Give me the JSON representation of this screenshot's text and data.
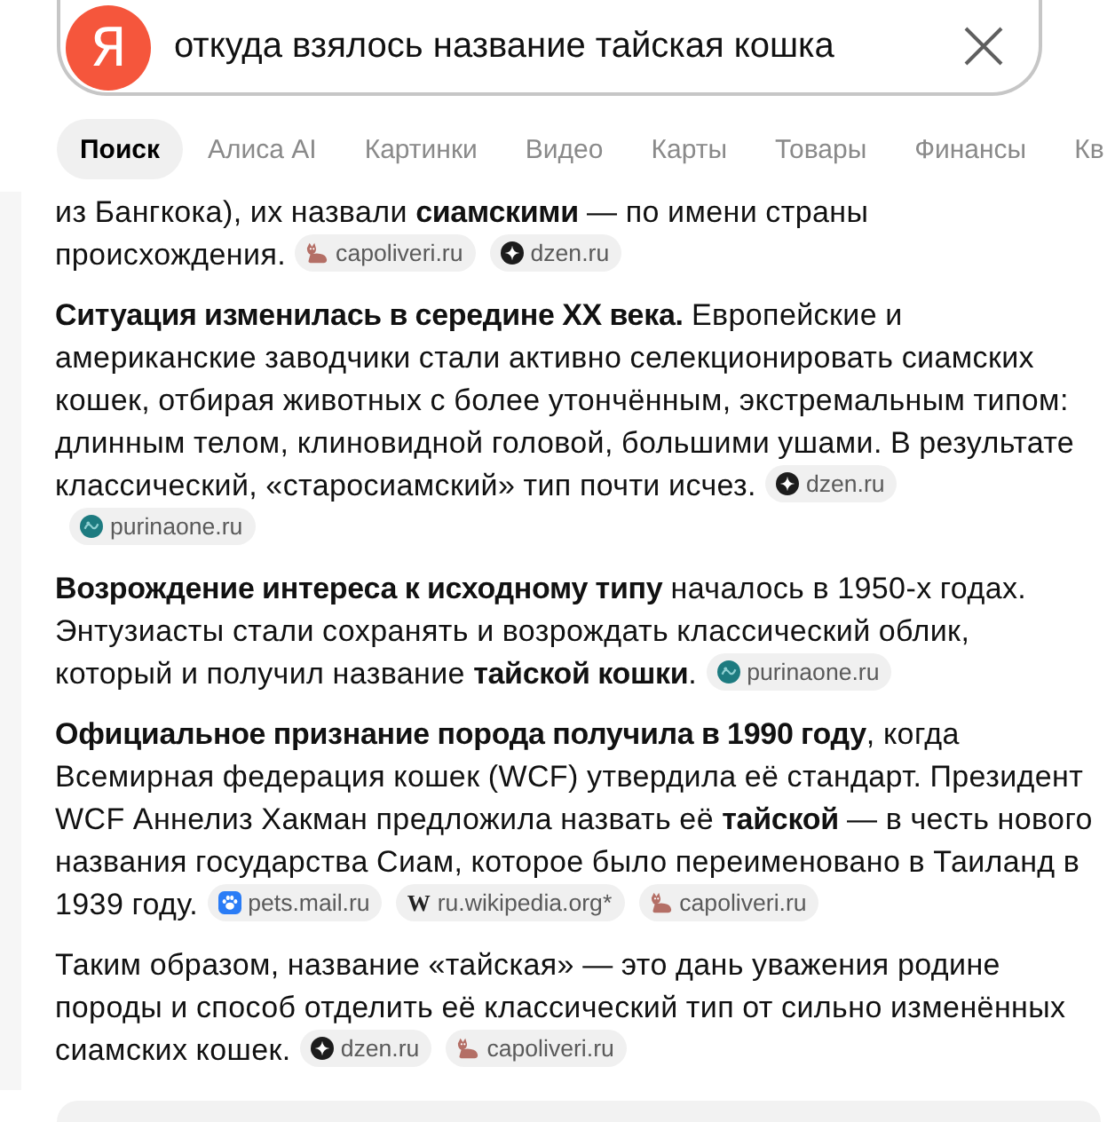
{
  "search": {
    "logo": "Я",
    "query": "откуда взялось название тайская кошка"
  },
  "tabs": [
    {
      "label": "Поиск",
      "selected": true
    },
    {
      "label": "Алиса AI",
      "selected": false
    },
    {
      "label": "Картинки",
      "selected": false
    },
    {
      "label": "Видео",
      "selected": false
    },
    {
      "label": "Карты",
      "selected": false
    },
    {
      "label": "Товары",
      "selected": false
    },
    {
      "label": "Финансы",
      "selected": false
    },
    {
      "label": "Кв",
      "selected": false
    }
  ],
  "answer": {
    "paragraphs": [
      {
        "text": "из Бангкока), их назвали **сиамскими** — по имени страны происхождения.",
        "sources": [
          {
            "name": "capoliveri.ru",
            "kind": "cat"
          },
          {
            "name": "dzen.ru",
            "kind": "sparkle"
          }
        ]
      },
      {
        "text": "**Ситуация изменилась в середине XX века.** Европейские и американские заводчики стали активно селекционировать сиамских кошек, отбирая животных с более утончённым, экстремальным типом: длинным телом, клиновидной головой, большими ушами. В результате классический, «старосиамский» тип почти исчез.",
        "sources": [
          {
            "name": "dzen.ru",
            "kind": "sparkle"
          },
          {
            "name": "purinaone.ru",
            "kind": "emblem"
          }
        ]
      },
      {
        "text": "**Возрождение интереса к исходному типу** началось в 1950-х годах. Энтузиасты стали сохранять и возрождать классический облик, который и получил название **тайской кошки**.",
        "sources": [
          {
            "name": "purinaone.ru",
            "kind": "emblem"
          }
        ]
      },
      {
        "text": "**Официальное признание порода получила в 1990 году**, когда Всемирная федерация кошек (WCF) утвердила её стандарт. Президент WCF Аннелиз Хакман предложила назвать её **тайской** — в честь нового названия государства Сиам, которое было переименовано в Таиланд в 1939 году.",
        "sources": [
          {
            "name": "pets.mail.ru",
            "kind": "paw"
          },
          {
            "name": "ru.wikipedia.org*",
            "kind": "letter",
            "letter": "W"
          },
          {
            "name": "capoliveri.ru",
            "kind": "cat"
          }
        ]
      },
      {
        "text": "Таким образом, название «тайская» — это дань уважения родине породы и способ отделить её классический тип от сильно изменённых сиамских кошек.",
        "sources": [
          {
            "name": "dzen.ru",
            "kind": "sparkle"
          },
          {
            "name": "capoliveri.ru",
            "kind": "cat"
          }
        ]
      }
    ]
  }
}
